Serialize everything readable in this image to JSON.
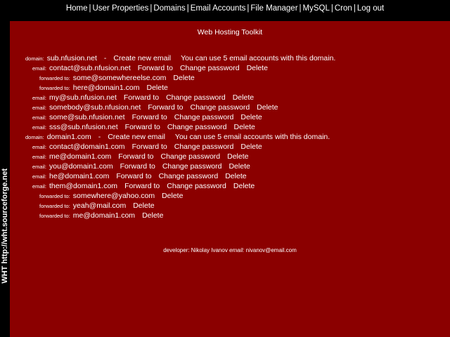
{
  "nav": {
    "items": [
      "Home",
      "User Properties",
      "Domains",
      "Email Accounts",
      "File Manager",
      "MySQL",
      "Cron",
      "Log out"
    ],
    "separator": "|"
  },
  "sidebar": {
    "vertical_text": "WHT  http://wht.sourceforge.net"
  },
  "page_title": "Web Hosting Toolkit",
  "labels": {
    "domain": "domain:",
    "email": "email:",
    "forwarded": "forwarded to:"
  },
  "actions": {
    "create_email": "Create new email",
    "forward_to": "Forward to",
    "change_password": "Change password",
    "delete": "Delete"
  },
  "domains": [
    {
      "name": "sub.nfusion.net",
      "info": "You can use 5 email accounts with this domain.",
      "emails": [
        {
          "address": "contact@sub.nfusion.net",
          "forwards": [
            "some@somewhereelse.com",
            "here@domain1.com"
          ]
        },
        {
          "address": "my@sub.nfusion.net",
          "forwards": []
        },
        {
          "address": "somebody@sub.nfusion.net",
          "forwards": []
        },
        {
          "address": "some@sub.nfusion.net",
          "forwards": []
        },
        {
          "address": "sss@sub.nfusion.net",
          "forwards": []
        }
      ]
    },
    {
      "name": "domain1.com",
      "info": "You can use 5 email accounts with this domain.",
      "emails": [
        {
          "address": "contact@domain1.com",
          "forwards": []
        },
        {
          "address": "me@domain1.com",
          "forwards": []
        },
        {
          "address": "you@domain1.com",
          "forwards": []
        },
        {
          "address": "he@domain1.com",
          "forwards": []
        },
        {
          "address": "them@domain1.com",
          "forwards": [
            "somewhere@yahoo.com",
            "yeah@mail.com",
            "me@domain1.com"
          ]
        }
      ]
    }
  ],
  "footer": {
    "developer_label": "developer:",
    "developer_name": "Nikolay Ivanov",
    "email_label": "email:",
    "email": "nivanov@email.com"
  },
  "colors": {
    "background": "#000000",
    "panel": "#8b0000",
    "text": "#ffffff"
  }
}
